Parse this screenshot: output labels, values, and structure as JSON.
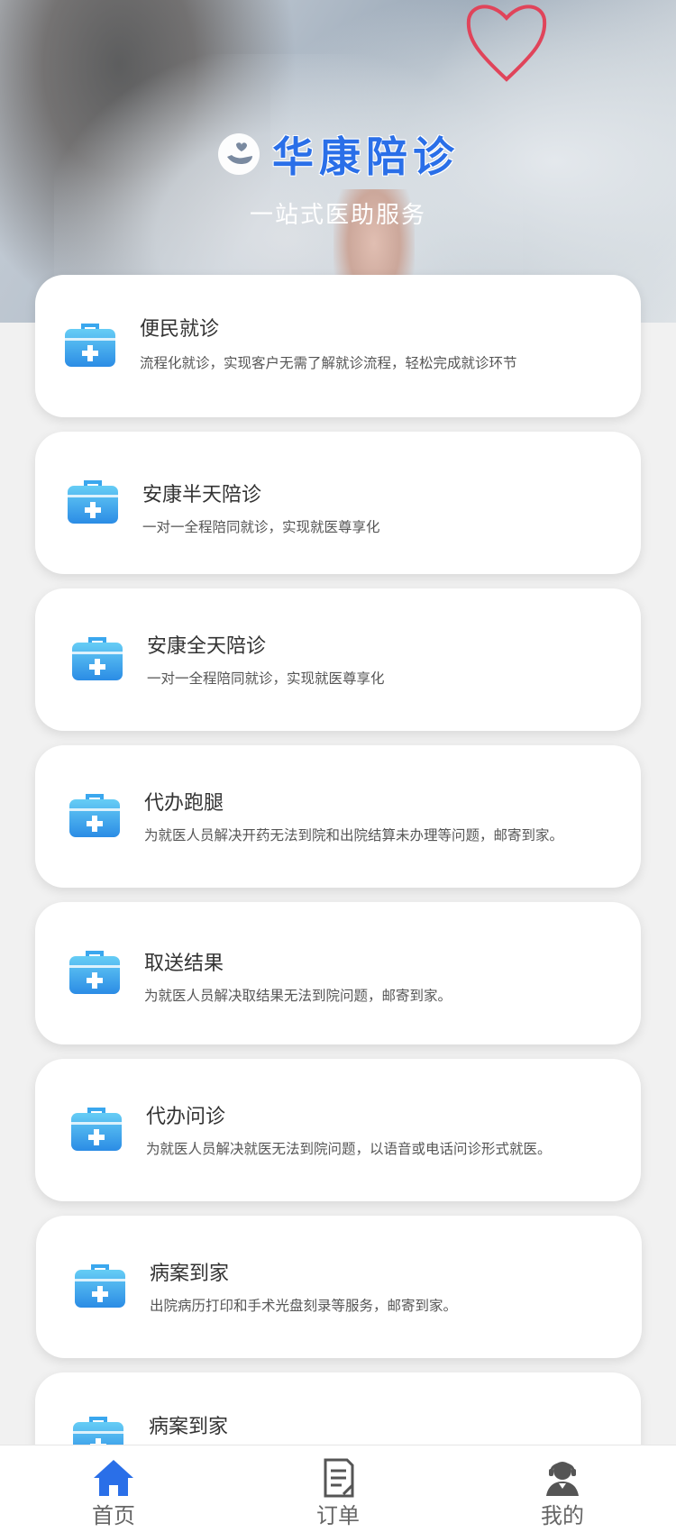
{
  "app": {
    "brand_title": "华康陪诊",
    "brand_subtitle": "一站式医助服务"
  },
  "services": [
    {
      "title": "便民就诊",
      "desc": "流程化就诊，实现客户无需了解就诊流程，轻松完成就诊环节"
    },
    {
      "title": "安康半天陪诊",
      "desc": "一对一全程陪同就诊，实现就医尊享化"
    },
    {
      "title": "安康全天陪诊",
      "desc": "一对一全程陪同就诊，实现就医尊享化"
    },
    {
      "title": "代办跑腿",
      "desc": "为就医人员解决开药无法到院和出院结算未办理等问题，邮寄到家。"
    },
    {
      "title": "取送结果",
      "desc": "为就医人员解决取结果无法到院问题，邮寄到家。"
    },
    {
      "title": "代办问诊",
      "desc": "为就医人员解决就医无法到院问题，以语音或电话问诊形式就医。"
    },
    {
      "title": "病案到家",
      "desc": "出院病历打印和手术光盘刻录等服务，邮寄到家。"
    },
    {
      "title": "病案到家",
      "desc": ""
    }
  ],
  "tabbar": {
    "home_label": "首页",
    "orders_label": "订单",
    "mine_label": "我的"
  },
  "colors": {
    "accent": "#2a6fe8",
    "icon_top": "#5bc6f3",
    "icon_bottom": "#2f8fe6",
    "tab_active": "#2a6fe8",
    "tab_inactive": "#555555"
  },
  "icons": {
    "logo": "hand-heart-logo-icon",
    "service": "medical-kit-icon",
    "home": "home-icon",
    "orders": "document-icon",
    "mine": "user-agent-icon"
  }
}
